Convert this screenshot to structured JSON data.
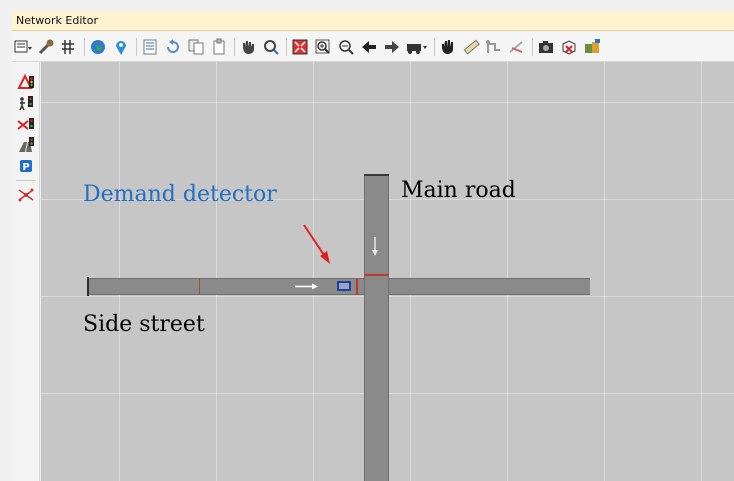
{
  "window": {
    "title": "Network Editor"
  },
  "toolbar": {
    "groups": [
      [
        "net-menu-icon",
        "wrench-icon",
        "grid-icon"
      ],
      [
        "globe-icon",
        "map-pin-icon"
      ],
      [
        "list-icon",
        "undo-icon",
        "copy-icon",
        "paste-icon"
      ],
      [
        "hand-select-icon",
        "rotate-select-icon"
      ],
      [
        "zoom-fit-icon",
        "zoom-in-icon",
        "zoom-out-icon",
        "arrow-left-icon",
        "arrow-right-icon",
        "vehicle-icon"
      ],
      [
        "pan-hand-icon",
        "measure-icon",
        "route-icon",
        "no-route-icon"
      ],
      [
        "camera-icon",
        "3d-box-icon",
        "3d-view-icon"
      ]
    ]
  },
  "sidebar": {
    "items": [
      "signal-warning-icon",
      "pedestrian-signal-icon",
      "conflict-signal-icon",
      "road-signal-icon",
      "parking-icon",
      "network-edit-icon"
    ]
  },
  "canvas": {
    "labels": {
      "demand_detector": "Demand detector",
      "main_road": "Main road",
      "side_street": "Side street"
    }
  },
  "colors": {
    "titlebar": "#fdf3d0",
    "canvas": "#c6c6c6",
    "road": "#8a8a8a",
    "stopline": "#c0392b",
    "detector": "#1f3fa0",
    "annotation_blue": "#1f6fc5",
    "arrow_red": "#e02020"
  }
}
